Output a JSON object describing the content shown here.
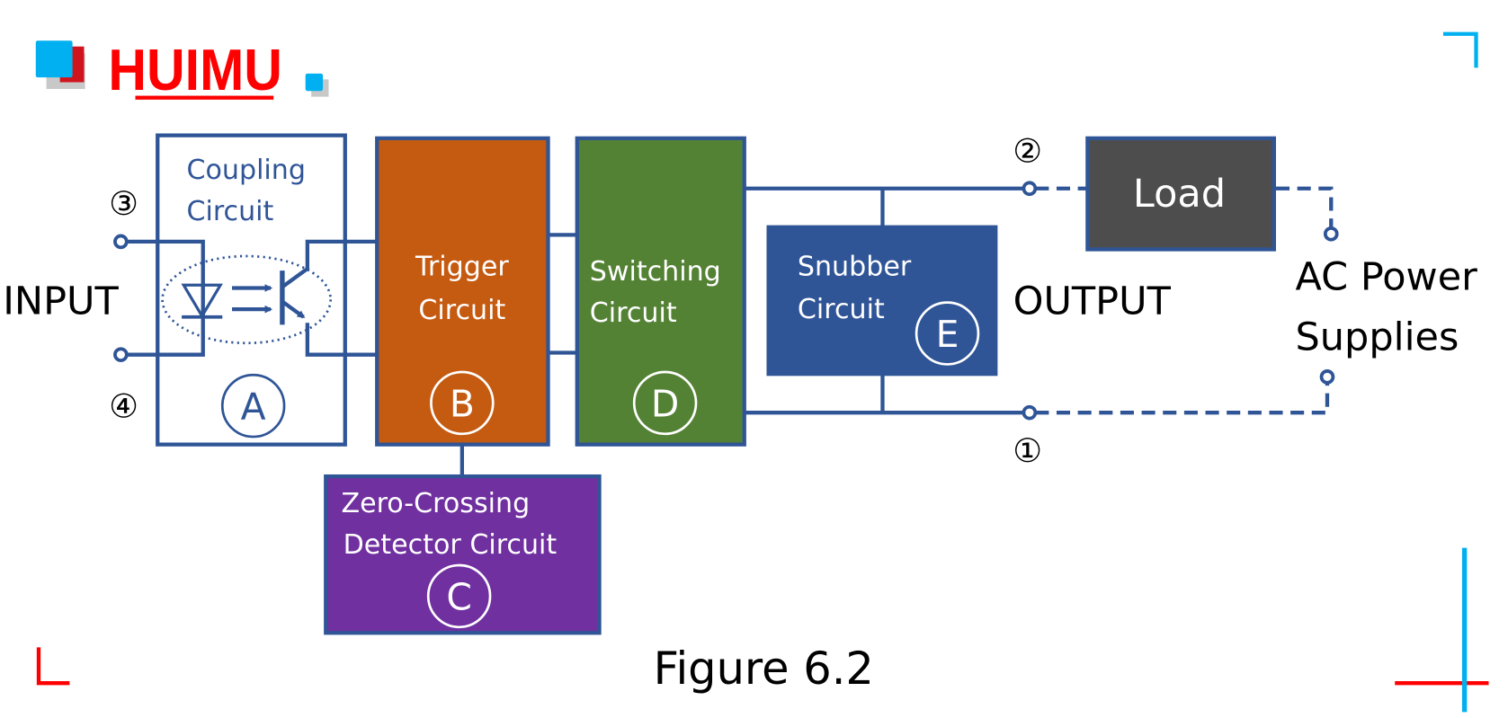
{
  "logo": {
    "text": "HUIMU",
    "colors": {
      "blue": "#00b0f0",
      "red": "#ff0000",
      "shadow": "#c8c8c8"
    }
  },
  "labels": {
    "input": "INPUT",
    "output": "OUTPUT",
    "ac_power_line1": "AC Power",
    "ac_power_line2": "Supplies",
    "figure_caption": "Figure 6.2"
  },
  "terminals": {
    "t1": "①",
    "t2": "②",
    "t3": "③",
    "t4": "④"
  },
  "blocks": {
    "coupling": {
      "line1": "Coupling",
      "line2": "Circuit",
      "letter": "A",
      "color": "#ffffff"
    },
    "trigger": {
      "line1": "Trigger",
      "line2": "Circuit",
      "letter": "B",
      "color": "#c55a11"
    },
    "zero_crossing": {
      "line1": "Zero-Crossing",
      "line2": "Detector Circuit",
      "letter": "C",
      "color": "#7030a0"
    },
    "switching": {
      "line1": "Switching",
      "line2": "Circuit",
      "letter": "D",
      "color": "#548235"
    },
    "snubber": {
      "line1": "Snubber",
      "line2": "Circuit",
      "letter": "E",
      "color": "#2f5597"
    },
    "load": {
      "label": "Load",
      "color": "#4d4d4d"
    }
  },
  "colors": {
    "wire": "#2f5597",
    "corner_blue": "#00b0f0",
    "corner_red": "#ff0000"
  }
}
